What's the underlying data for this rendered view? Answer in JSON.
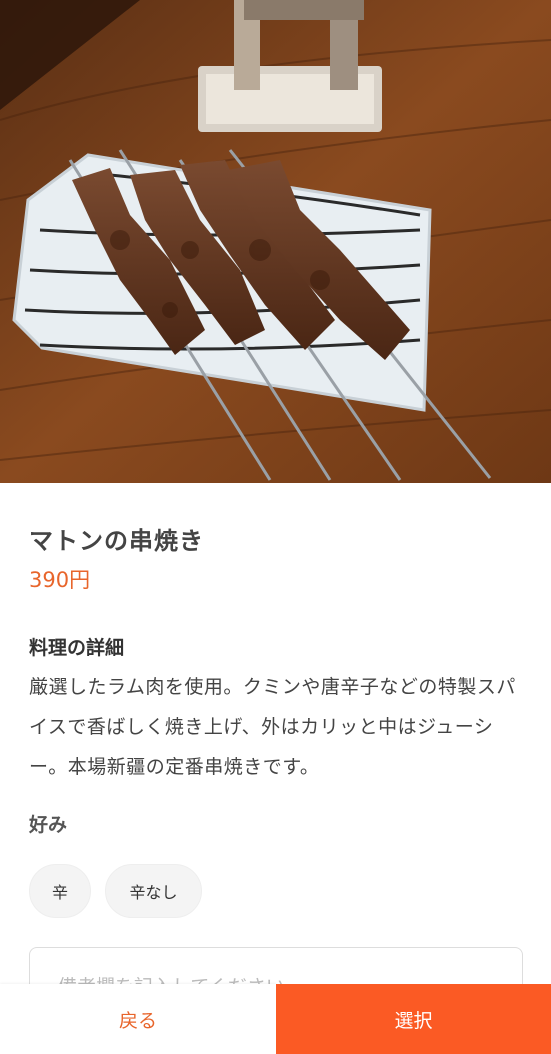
{
  "hero": {
    "image_alt": "food-photo"
  },
  "dish": {
    "name": "マトンの串焼き",
    "price": "390円"
  },
  "detail": {
    "title": "料理の詳細",
    "text": "厳選したラム肉を使用。クミンや唐辛子などの特製スパイスで香ばしく焼き上げ、外はカリッと中はジューシー。本場新疆の定番串焼きです。"
  },
  "preference": {
    "title": "好み",
    "options": [
      "辛",
      "辛なし"
    ]
  },
  "note": {
    "placeholder": "備考欄を記入してください"
  },
  "footer": {
    "back_label": "戻る",
    "select_label": "選択"
  },
  "colors": {
    "accent": "#fb5a24",
    "price": "#e8652b"
  }
}
